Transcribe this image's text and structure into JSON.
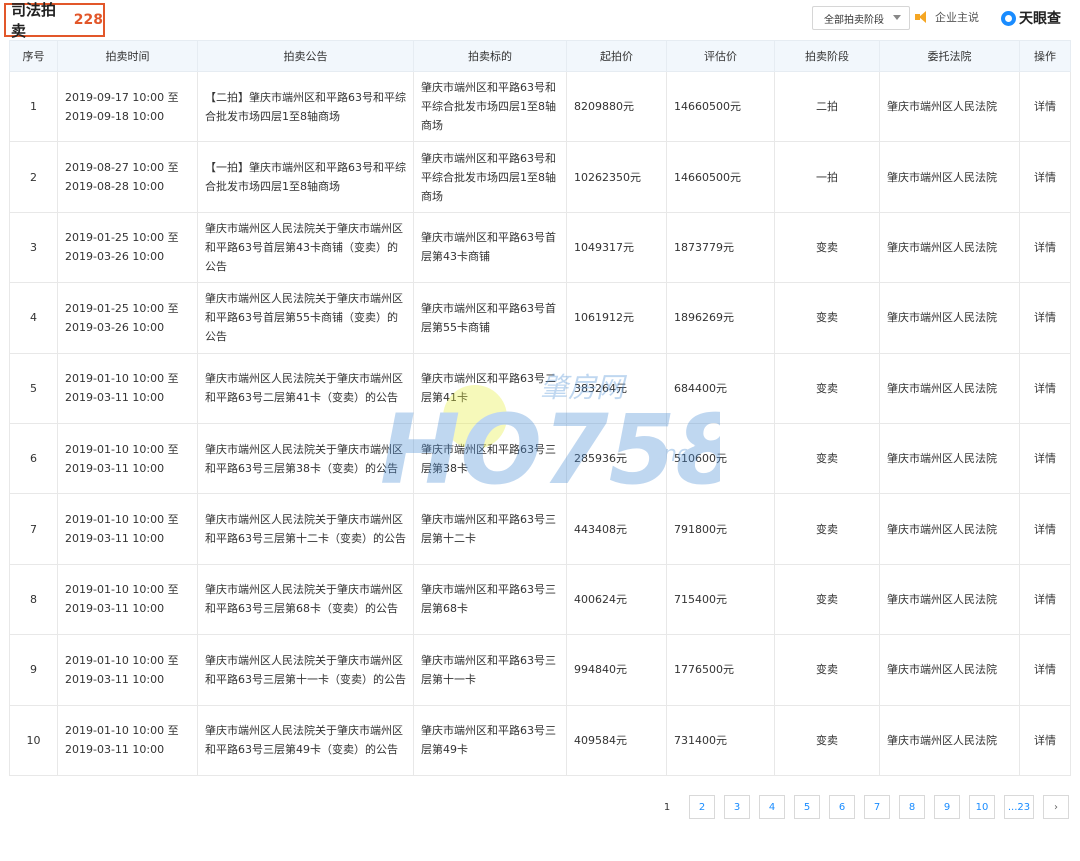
{
  "header": {
    "title": "司法拍卖",
    "count": "228",
    "stage_filter": "全部拍卖阶段",
    "enterprise_link": "企业主说",
    "brand": "天眼查"
  },
  "table": {
    "columns": [
      "序号",
      "拍卖时间",
      "拍卖公告",
      "拍卖标的",
      "起拍价",
      "评估价",
      "拍卖阶段",
      "委托法院",
      "操作"
    ],
    "rows": [
      {
        "idx": "1",
        "time": "2019-09-17 10:00 至 2019-09-18 10:00",
        "announcement": "【二拍】肇庆市端州区和平路63号和平综合批发市场四层1至8轴商场",
        "target": "肇庆市端州区和平路63号和平综合批发市场四层1至8轴商场",
        "start_price": "8209880元",
        "valuation": "14660500元",
        "stage": "二拍",
        "court": "肇庆市端州区人民法院",
        "action": "详情"
      },
      {
        "idx": "2",
        "time": "2019-08-27 10:00 至 2019-08-28 10:00",
        "announcement": "【一拍】肇庆市端州区和平路63号和平综合批发市场四层1至8轴商场",
        "target": "肇庆市端州区和平路63号和平综合批发市场四层1至8轴商场",
        "start_price": "10262350元",
        "valuation": "14660500元",
        "stage": "一拍",
        "court": "肇庆市端州区人民法院",
        "action": "详情"
      },
      {
        "idx": "3",
        "time": "2019-01-25 10:00 至 2019-03-26 10:00",
        "announcement": "肇庆市端州区人民法院关于肇庆市端州区和平路63号首层第43卡商铺（变卖）的公告",
        "target": "肇庆市端州区和平路63号首层第43卡商铺",
        "start_price": "1049317元",
        "valuation": "1873779元",
        "stage": "变卖",
        "court": "肇庆市端州区人民法院",
        "action": "详情"
      },
      {
        "idx": "4",
        "time": "2019-01-25 10:00 至 2019-03-26 10:00",
        "announcement": "肇庆市端州区人民法院关于肇庆市端州区和平路63号首层第55卡商铺（变卖）的公告",
        "target": "肇庆市端州区和平路63号首层第55卡商铺",
        "start_price": "1061912元",
        "valuation": "1896269元",
        "stage": "变卖",
        "court": "肇庆市端州区人民法院",
        "action": "详情"
      },
      {
        "idx": "5",
        "time": "2019-01-10 10:00 至 2019-03-11 10:00",
        "announcement": "肇庆市端州区人民法院关于肇庆市端州区和平路63号二层第41卡（变卖）的公告",
        "target": "肇庆市端州区和平路63号二层第41卡",
        "start_price": "383264元",
        "valuation": "684400元",
        "stage": "变卖",
        "court": "肇庆市端州区人民法院",
        "action": "详情"
      },
      {
        "idx": "6",
        "time": "2019-01-10 10:00 至 2019-03-11 10:00",
        "announcement": "肇庆市端州区人民法院关于肇庆市端州区和平路63号三层第38卡（变卖）的公告",
        "target": "肇庆市端州区和平路63号三层第38卡",
        "start_price": "285936元",
        "valuation": "510600元",
        "stage": "变卖",
        "court": "肇庆市端州区人民法院",
        "action": "详情"
      },
      {
        "idx": "7",
        "time": "2019-01-10 10:00 至 2019-03-11 10:00",
        "announcement": "肇庆市端州区人民法院关于肇庆市端州区和平路63号三层第十二卡（变卖）的公告",
        "target": "肇庆市端州区和平路63号三层第十二卡",
        "start_price": "443408元",
        "valuation": "791800元",
        "stage": "变卖",
        "court": "肇庆市端州区人民法院",
        "action": "详情"
      },
      {
        "idx": "8",
        "time": "2019-01-10 10:00 至 2019-03-11 10:00",
        "announcement": "肇庆市端州区人民法院关于肇庆市端州区和平路63号三层第68卡（变卖）的公告",
        "target": "肇庆市端州区和平路63号三层第68卡",
        "start_price": "400624元",
        "valuation": "715400元",
        "stage": "变卖",
        "court": "肇庆市端州区人民法院",
        "action": "详情"
      },
      {
        "idx": "9",
        "time": "2019-01-10 10:00 至 2019-03-11 10:00",
        "announcement": "肇庆市端州区人民法院关于肇庆市端州区和平路63号三层第十一卡（变卖）的公告",
        "target": "肇庆市端州区和平路63号三层第十一卡",
        "start_price": "994840元",
        "valuation": "1776500元",
        "stage": "变卖",
        "court": "肇庆市端州区人民法院",
        "action": "详情"
      },
      {
        "idx": "10",
        "time": "2019-01-10 10:00 至 2019-03-11 10:00",
        "announcement": "肇庆市端州区人民法院关于肇庆市端州区和平路63号三层第49卡（变卖）的公告",
        "target": "肇庆市端州区和平路63号三层第49卡",
        "start_price": "409584元",
        "valuation": "731400元",
        "stage": "变卖",
        "court": "肇庆市端州区人民法院",
        "action": "详情"
      }
    ]
  },
  "pagination": {
    "current": "1",
    "pages": [
      "2",
      "3",
      "4",
      "5",
      "6",
      "7",
      "8",
      "9",
      "10"
    ],
    "last": "...23",
    "next_symbol": "›"
  },
  "watermark": {
    "logo_text": "HO758",
    "site_name": "肇房网",
    "suffix": ".net"
  },
  "colors": {
    "accent": "#e2572a",
    "link": "#1a8cff",
    "header_bg": "#f2f7fc"
  }
}
